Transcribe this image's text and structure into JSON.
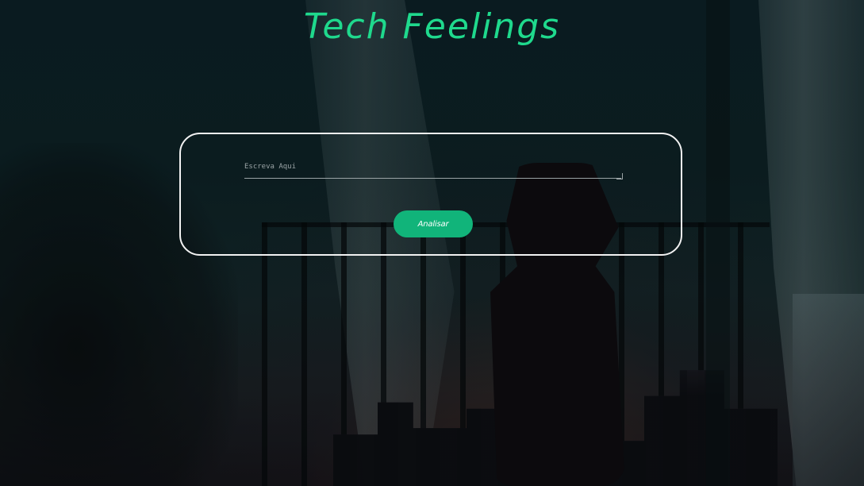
{
  "header": {
    "title": "Tech Feelings"
  },
  "form": {
    "placeholder": "Escreva Aqui",
    "value": "",
    "submit_label": "Analisar"
  },
  "colors": {
    "accent": "#1fd98d",
    "button": "#11b47a",
    "panel_border": "#f2f2f2"
  }
}
